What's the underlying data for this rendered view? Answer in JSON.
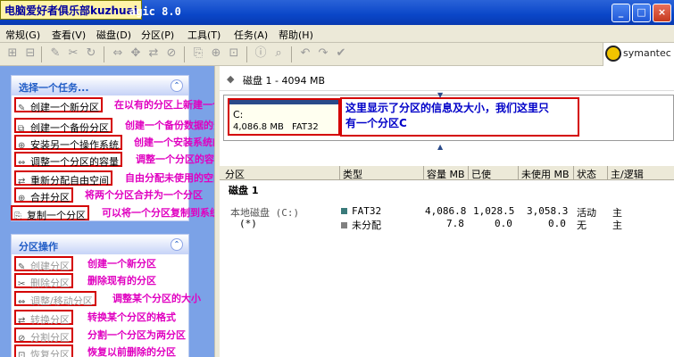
{
  "window": {
    "title_overlay": "电脑爱好者俱乐部kuzhuai",
    "title_suffix": "agic 8.0",
    "controls": [
      "_",
      "□",
      "×"
    ]
  },
  "menu": [
    "常规(G)",
    "查看(V)",
    "磁盘(D)",
    "分区(P)",
    "工具(T)",
    "任务(A)",
    "帮助(H)"
  ],
  "brand": {
    "name": "symantec"
  },
  "tasks": {
    "header": "选择一个任务...",
    "items": [
      {
        "label": "创建一个新分区",
        "note": "在以有的分区上新建一个分区"
      },
      {
        "label": "创建一个备份分区",
        "note": "创建一个备份数据的分区"
      },
      {
        "label": "安装另一个操作系统",
        "note": "创建一个安装系统的分区"
      },
      {
        "label": "调整一个分区的容量",
        "note": "调整一个分区的容量"
      },
      {
        "label": "重新分配自由空间",
        "note": "自由分配未使用的空间"
      },
      {
        "label": "合并分区",
        "note": "将两个分区合并为一个分区"
      },
      {
        "label": "复制一个分区",
        "note": "可以将一个分区复制到系统的另一个位置"
      }
    ]
  },
  "partition_ops": {
    "header": "分区操作",
    "items": [
      {
        "label": "创建分区",
        "note": "创建一个新分区"
      },
      {
        "label": "删除分区",
        "note": "删除现有的分区"
      },
      {
        "label": "调整/移动分区",
        "note": "调整某个分区的大小"
      },
      {
        "label": "转换分区",
        "note": "转换某个分区的格式"
      },
      {
        "label": "分割分区",
        "note": "分割一个分区为两分区"
      },
      {
        "label": "恢复分区",
        "note": "恢复以前删除的分区"
      }
    ]
  },
  "disk": {
    "title": "磁盘 1 - 4094 MB",
    "partition_block": {
      "name": "C:",
      "size": "4,086.8 MB",
      "fs": "FAT32"
    },
    "note_line1": "这里显示了分区的信息及大小，我们这里只",
    "note_line2": "有一个分区C"
  },
  "table": {
    "columns": [
      "分区",
      "类型",
      "容量 MB",
      "已使",
      "未使用 MB",
      "状态",
      "主/逻辑"
    ],
    "group": "磁盘 1",
    "rows": [
      {
        "name": "本地磁盘 (C:)",
        "type": "FAT32",
        "capacity": "4,086.8",
        "used": "1,028.5",
        "unused": "3,058.3",
        "status": "活动",
        "kind": "主",
        "color": "#3a7a7a"
      },
      {
        "name": "(*)",
        "type": "未分配",
        "capacity": "7.8",
        "used": "0.0",
        "unused": "0.0",
        "status": "无",
        "kind": "主",
        "color": "#808080"
      }
    ]
  }
}
